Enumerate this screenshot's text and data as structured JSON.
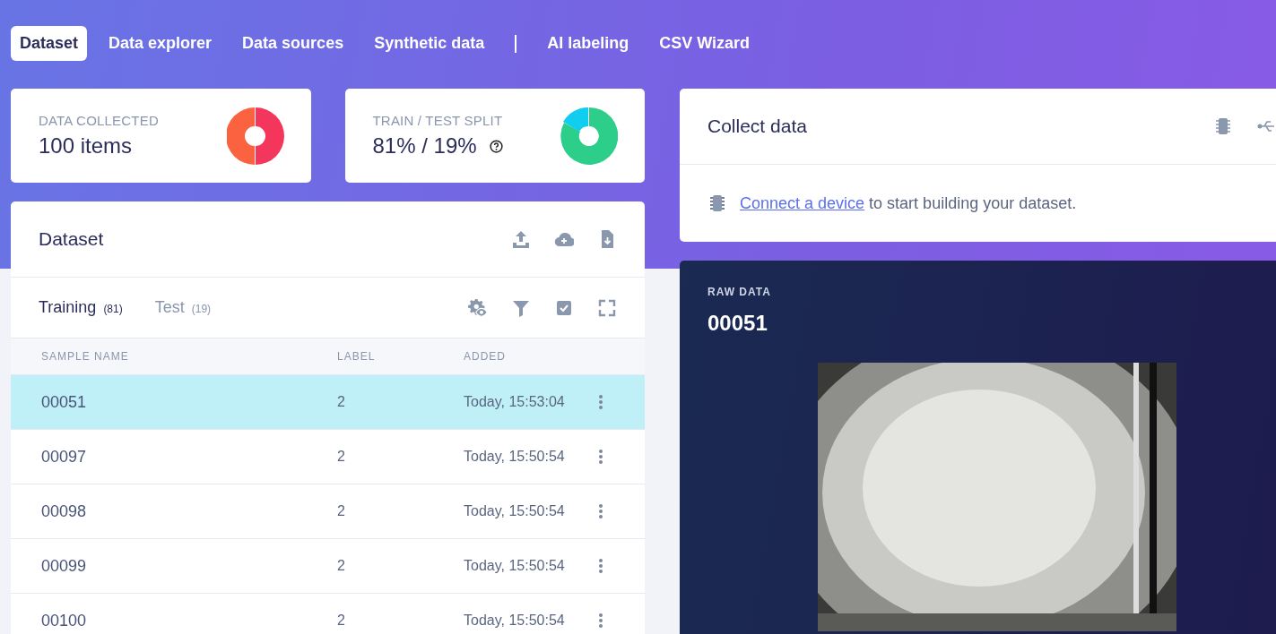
{
  "nav_tabs": [
    {
      "label": "Dataset",
      "selected": true
    },
    {
      "label": "Data explorer",
      "selected": false
    },
    {
      "label": "Data sources",
      "selected": false
    },
    {
      "label": "Synthetic data",
      "selected": false
    },
    {
      "label": "AI labeling",
      "selected": false,
      "divider_before": true
    },
    {
      "label": "CSV Wizard",
      "selected": false
    }
  ],
  "stats": [
    {
      "title": "DATA COLLECTED",
      "value": "100 items",
      "kind": "collected"
    },
    {
      "title": "TRAIN / TEST SPLIT",
      "value": "81% / 19%",
      "kind": "split",
      "help": true
    }
  ],
  "dataset": {
    "title": "Dataset",
    "sample_tabs": [
      {
        "label": "Training",
        "count": "(81)",
        "selected": true
      },
      {
        "label": "Test",
        "count": "(19)",
        "selected": false
      }
    ],
    "columns": [
      "SAMPLE NAME",
      "LABEL",
      "ADDED"
    ],
    "rows": [
      {
        "name": "00051",
        "label": "2",
        "added": "Today, 15:53:04",
        "selected": true
      },
      {
        "name": "00097",
        "label": "2",
        "added": "Today, 15:50:54",
        "selected": false
      },
      {
        "name": "00098",
        "label": "2",
        "added": "Today, 15:50:54",
        "selected": false
      },
      {
        "name": "00099",
        "label": "2",
        "added": "Today, 15:50:54",
        "selected": false
      },
      {
        "name": "00100",
        "label": "2",
        "added": "Today, 15:50:54",
        "selected": false
      }
    ]
  },
  "collect": {
    "title": "Collect data",
    "link": "Connect a device",
    "message": " to start building your dataset."
  },
  "raw_data": {
    "caption": "RAW DATA",
    "sample": "00051"
  }
}
